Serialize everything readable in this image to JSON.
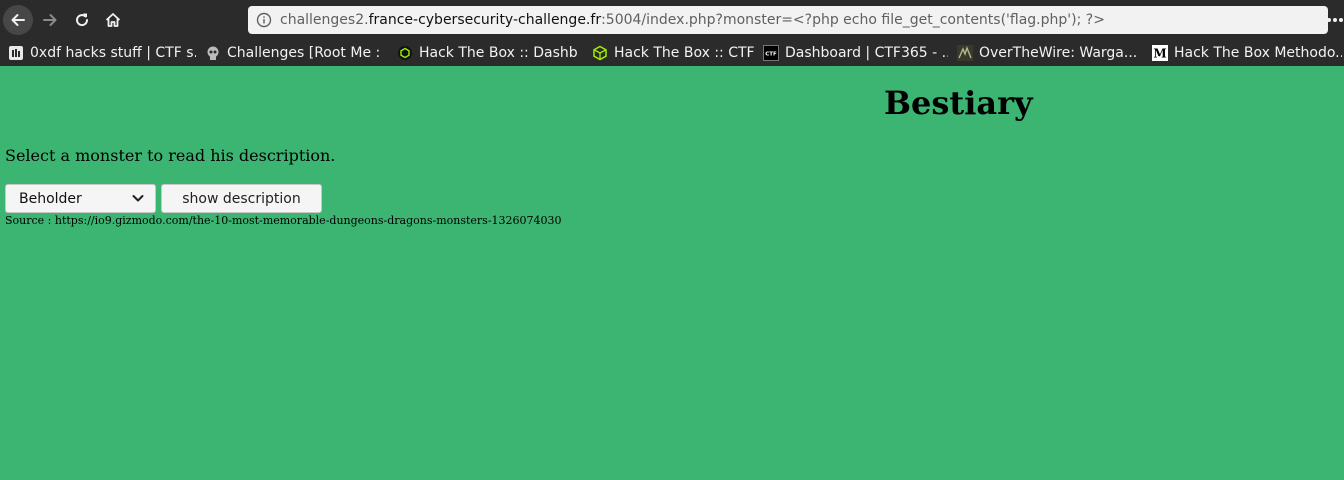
{
  "browser": {
    "url": {
      "prefix": "challenges2.",
      "domain": "france-cybersecurity-challenge.fr",
      "rest": ":5004/index.php?monster=<?php echo file_get_contents('flag.php'); ?>"
    },
    "icons": {
      "back": "back-arrow-icon",
      "forward": "forward-arrow-icon",
      "reload": "reload-icon",
      "home": "home-icon",
      "info": "info-icon",
      "menu": "more-dots-icon"
    },
    "bookmarks": [
      {
        "label": "0xdf hacks stuff | CTF s...",
        "icon": "0xdf-favicon"
      },
      {
        "label": "Challenges [Root Me : ...",
        "icon": "rootme-favicon"
      },
      {
        "label": "Hack The Box :: Dashb...",
        "icon": "htb-favicon"
      },
      {
        "label": "Hack The Box :: CTFs",
        "icon": "htb-cube-favicon"
      },
      {
        "label": "Dashboard | CTF365 - ...",
        "icon": "ctf365-favicon"
      },
      {
        "label": "OverTheWire: Warga...",
        "icon": "overthewire-favicon"
      },
      {
        "label": "Hack The Box Methodo...",
        "icon": "medium-favicon"
      }
    ]
  },
  "page": {
    "title": "Bestiary",
    "intro": "Select a monster to read his description.",
    "select_value": "Beholder",
    "button_label": "show description",
    "source": "Source : https://io9.gizmodo.com/the-10-most-memorable-dungeons-dragons-monsters-1326074030"
  },
  "colors": {
    "background": "#3db572",
    "toolbar": "#2b2b2b",
    "urlbar": "#f2f2f2"
  }
}
